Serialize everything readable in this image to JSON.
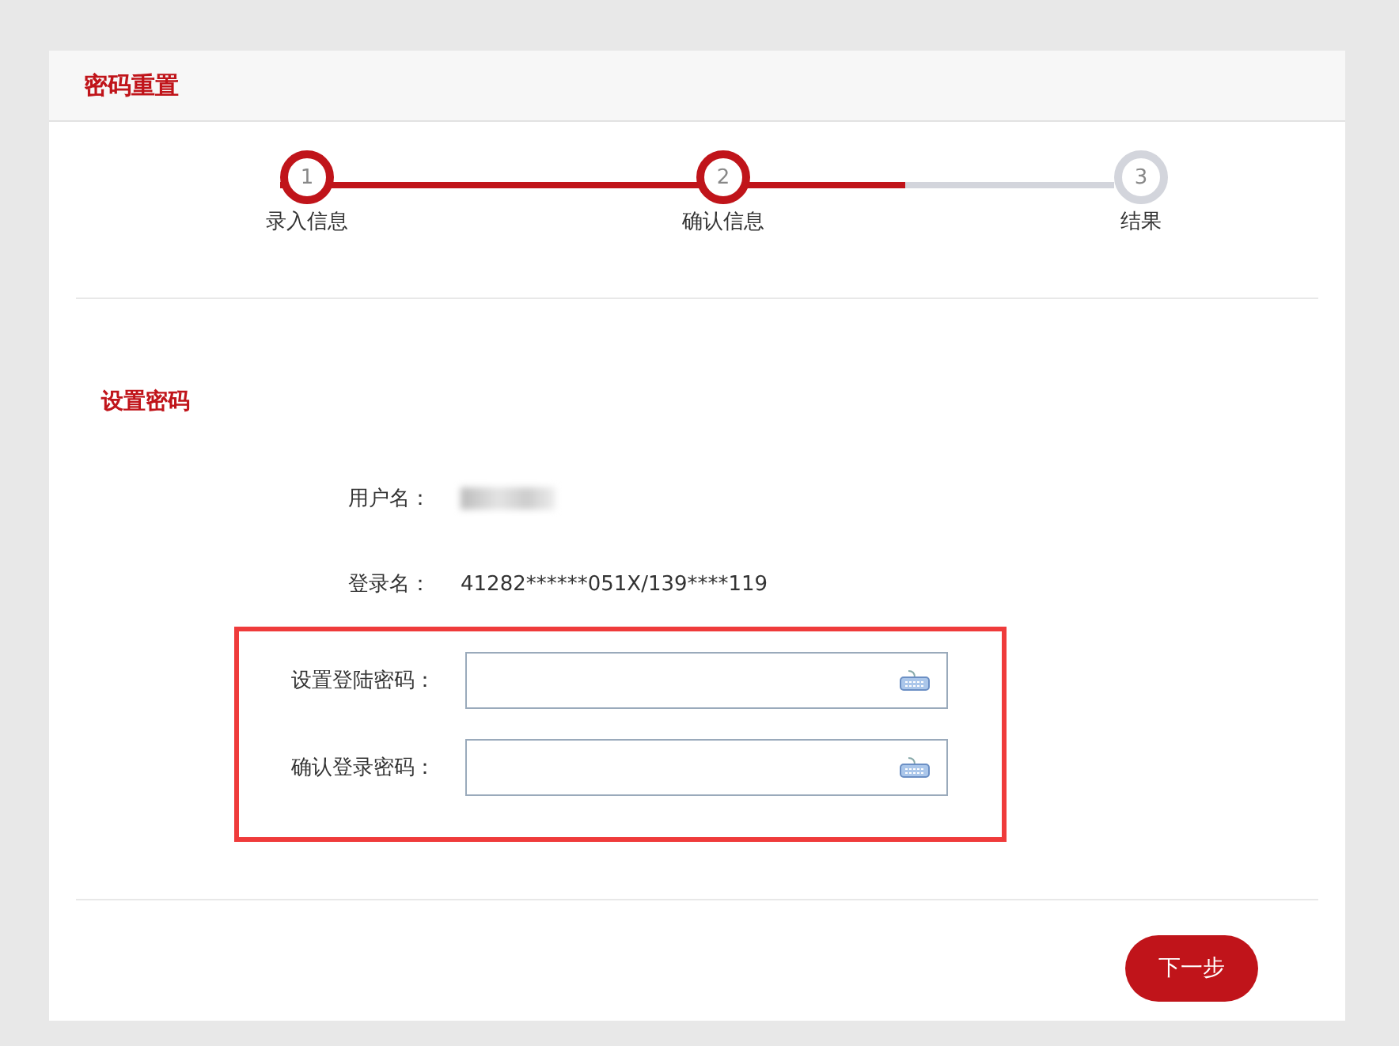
{
  "header": {
    "title": "密码重置"
  },
  "steps": [
    {
      "number": "1",
      "label": "录入信息",
      "completed": true
    },
    {
      "number": "2",
      "label": "确认信息",
      "completed": true
    },
    {
      "number": "3",
      "label": "结果",
      "completed": false
    }
  ],
  "progress": {
    "level": 0.75
  },
  "section": {
    "title": "设置密码"
  },
  "info": [
    {
      "label": "用户名：",
      "kind": "redacted"
    },
    {
      "label": "登录名：",
      "kind": "text",
      "value": "41282******051X/139****119"
    }
  ],
  "fields": [
    {
      "label": "设置登陆密码："
    },
    {
      "label": "确认登录密码："
    }
  ],
  "next_button": "下一步"
}
